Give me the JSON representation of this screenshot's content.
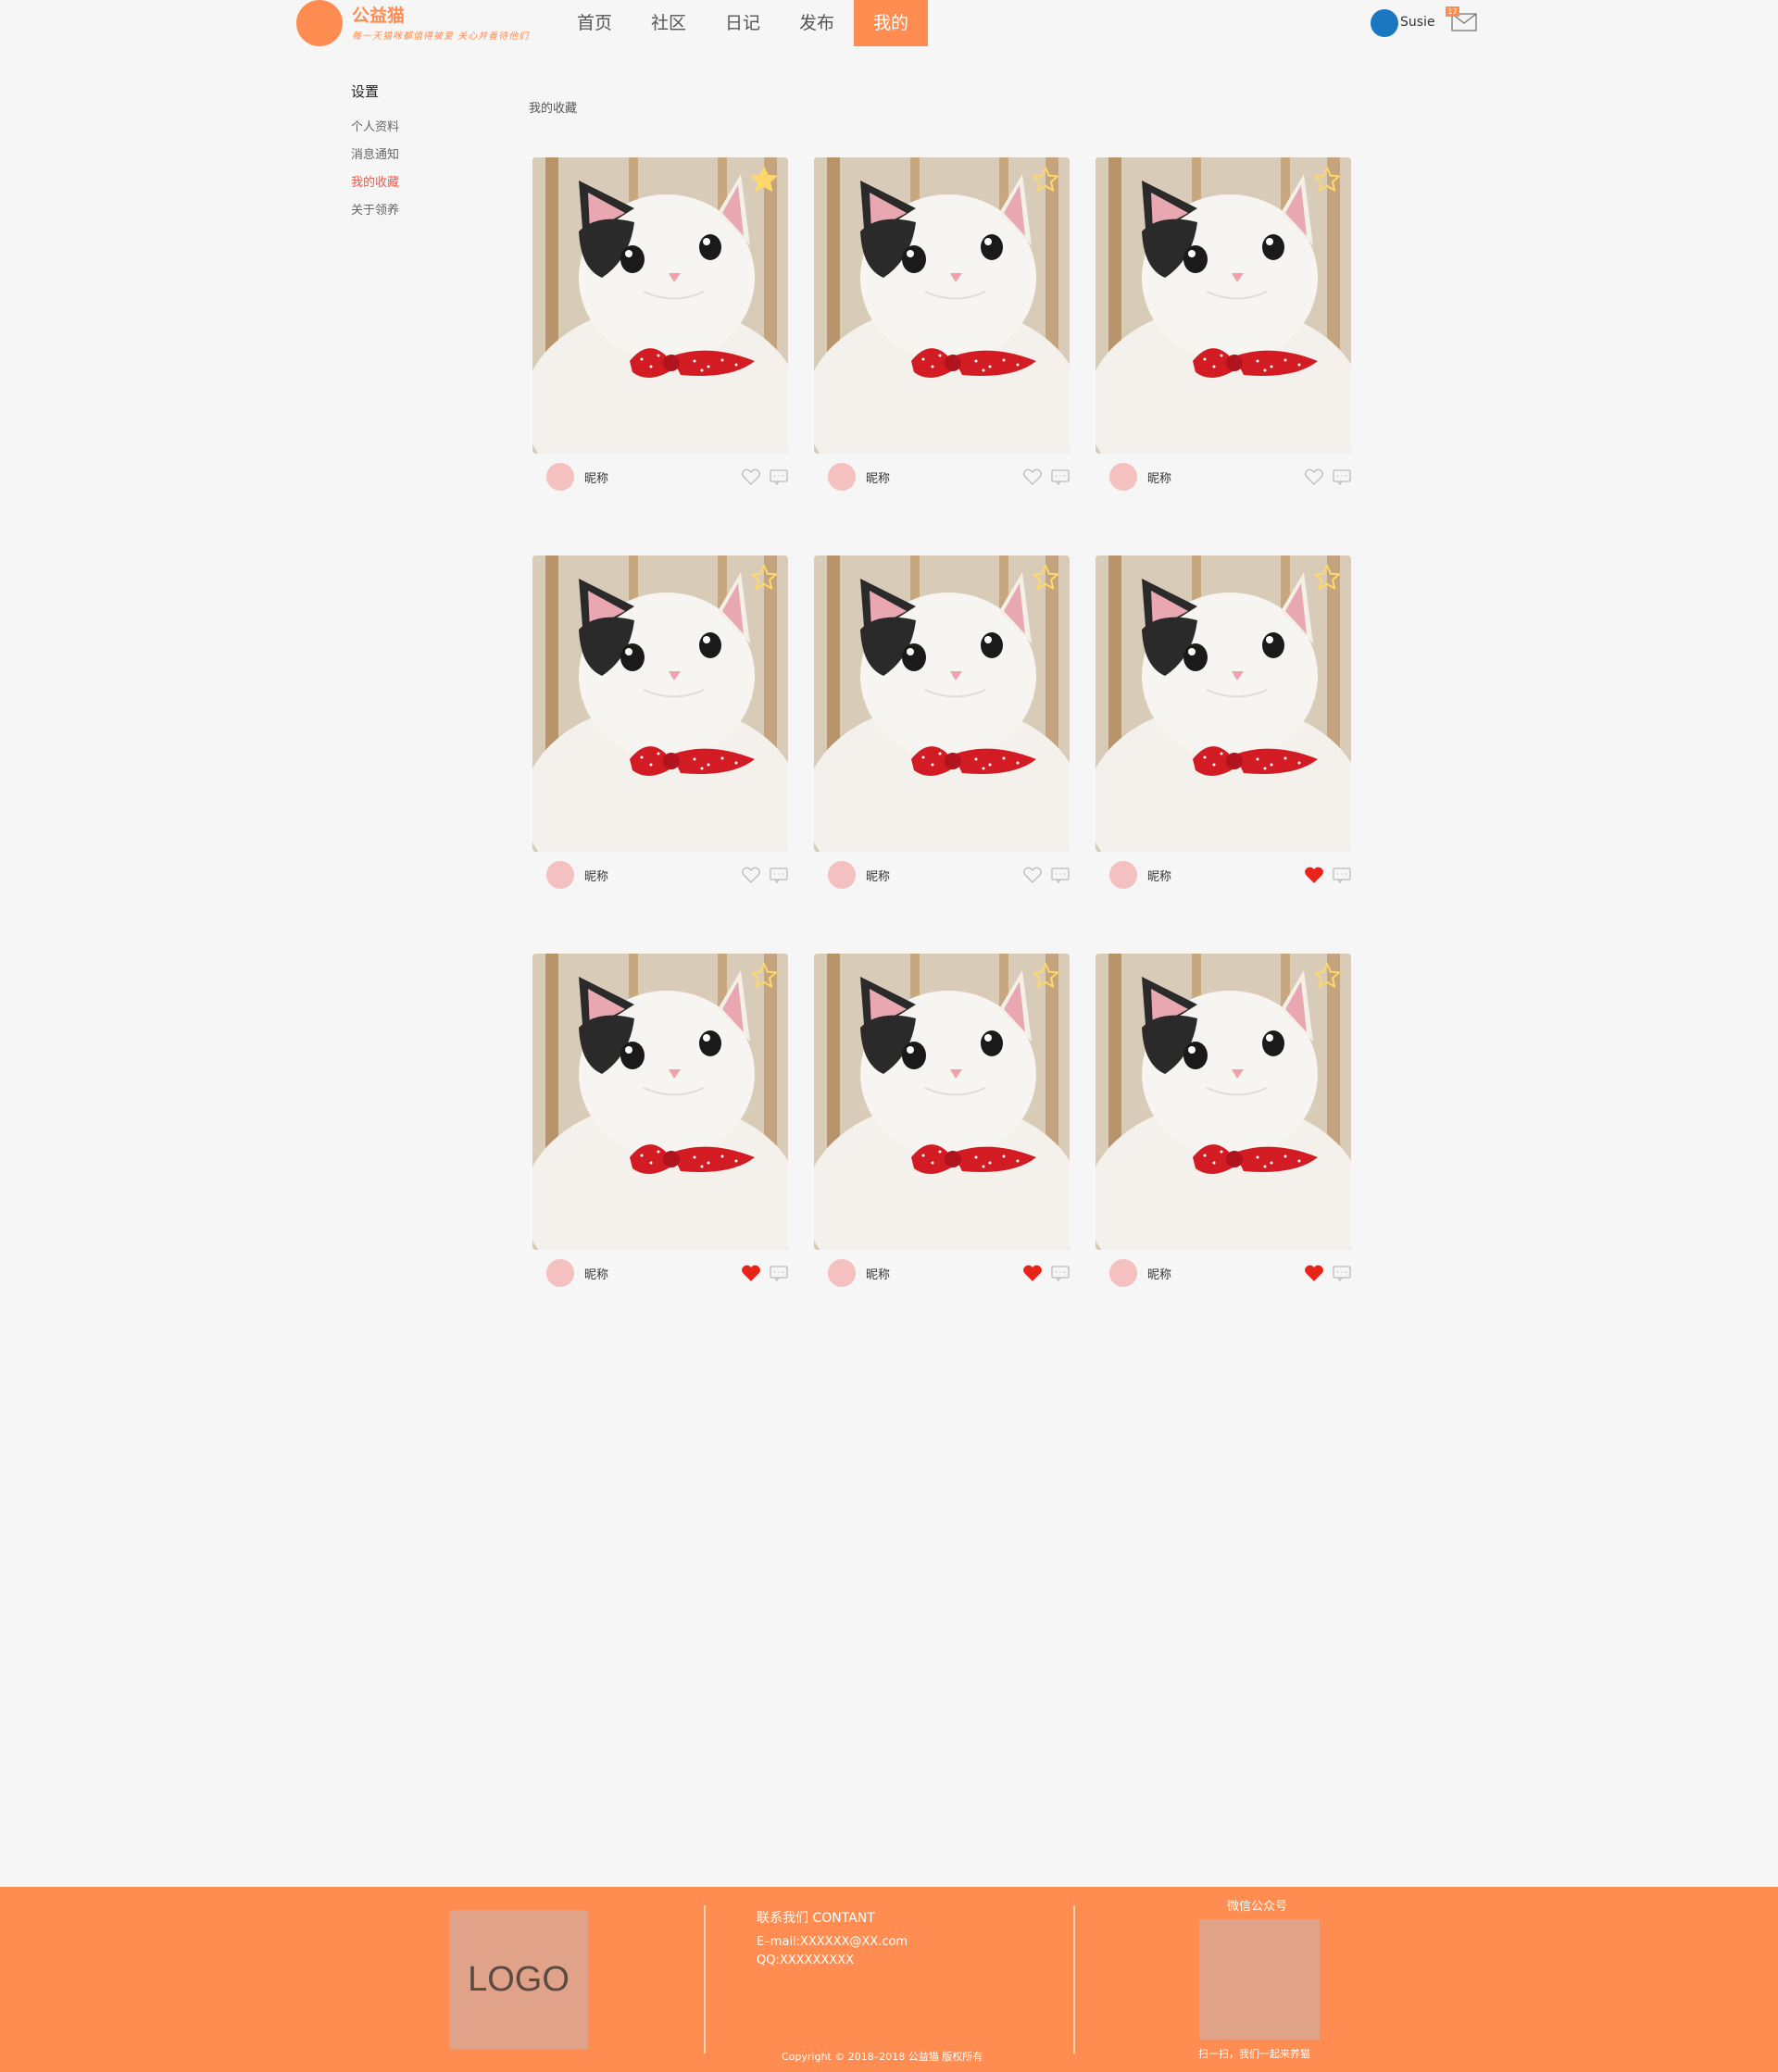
{
  "header": {
    "brand_name": "公益猫",
    "brand_slogan": "每一天猫咪都值得被爱 关心并善待他们",
    "nav": [
      "首页",
      "社区",
      "日记",
      "发布",
      "我的"
    ],
    "nav_active_index": 4,
    "user_name": "Susie",
    "mail_badge": "17"
  },
  "sidebar": {
    "title": "设置",
    "items": [
      "个人资料",
      "消息通知",
      "我的收藏",
      "关于领养"
    ],
    "active_index": 2
  },
  "section_title": "我的收藏",
  "cards": [
    {
      "nickname": "昵称",
      "starred": true,
      "liked": false
    },
    {
      "nickname": "昵称",
      "starred": false,
      "liked": false
    },
    {
      "nickname": "昵称",
      "starred": false,
      "liked": false
    },
    {
      "nickname": "昵称",
      "starred": false,
      "liked": false
    },
    {
      "nickname": "昵称",
      "starred": false,
      "liked": false
    },
    {
      "nickname": "昵称",
      "starred": false,
      "liked": true
    },
    {
      "nickname": "昵称",
      "starred": false,
      "liked": true
    },
    {
      "nickname": "昵称",
      "starred": false,
      "liked": true
    },
    {
      "nickname": "昵称",
      "starred": false,
      "liked": true
    }
  ],
  "footer": {
    "logo_text": "LOGO",
    "contact_title": "联系我们 CONTANT",
    "email": "E–mail:XXXXXX@XX.com",
    "qq": "QQ:XXXXXXXXX",
    "wechat_title": "微信公众号",
    "qr_caption": "扫一扫，我们一起来养猫",
    "copyright": "Copyright © 2018–2018 公益猫 版权所有"
  },
  "colors": {
    "accent": "#ff8c50",
    "active_sidebar": "#f0584a",
    "heart_liked": "#e8231a",
    "star_filled": "#ffd86a"
  }
}
